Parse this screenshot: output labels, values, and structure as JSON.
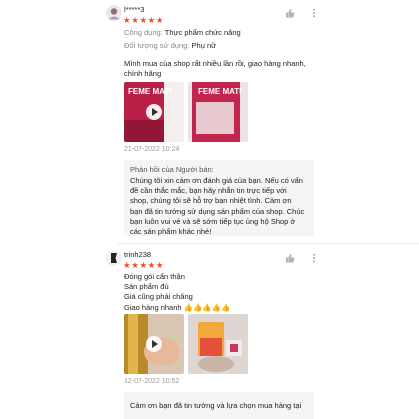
{
  "reviews": [
    {
      "username": "l*****3",
      "stars": "★★★★★",
      "attributes": [
        {
          "label": "Công dụng:",
          "value": "Thực phẩm chức năng"
        },
        {
          "label": "Đối tượng sử dụng:",
          "value": "Phụ nữ"
        }
      ],
      "comment_lines": [
        "Mình mua của shop rất nhiều lần rồi, giao hàng nhanh,",
        "chính hãng"
      ],
      "photo_labels": [
        "FEME MATI",
        "FEME MATI"
      ],
      "date": "21-07-2022 10:24",
      "seller_reply": {
        "title": "Phản hồi của Người bán:",
        "lines": [
          "Chúng tôi  xin cảm ơn đánh giá của bạn. Nếu có vấn",
          "đề cần thắc mắc, bạn hãy nhắn tin trực tiếp với",
          "shop, chúng tôi sẽ hỗ trợ bạn nhiệt tình. Cảm ơn",
          "bạn đã tin tưởng sử dụng sản phẩm của shop. Chúc",
          "bạn luôn vui vẻ và sẽ sớm tiếp tục ủng hộ Shop ở",
          "các sản phẩm khác nhé!"
        ]
      }
    },
    {
      "username": "trinh238",
      "stars": "★★★★★",
      "comment_lines": [
        "Đóng gói cẩn thận",
        "Sản phẩm đủ",
        "Giá cũng phải chăng",
        "Giao hàng nhanh 👍👍👍👍👍"
      ],
      "date": "12-07-2022 10:52",
      "seller_reply": {
        "title": "Phản hồi của Người bán:",
        "lines": [
          "Cảm ơn bạn đã tin tưởng và lựa chọn mua hàng tại"
        ]
      }
    }
  ],
  "colors": {
    "accent": "#ee4d2d",
    "reply_bg": "#f5f5f5",
    "muted": "#8a8a8a"
  },
  "icons": [
    "thumbs-up-icon",
    "more-dots-icon",
    "play-icon"
  ]
}
